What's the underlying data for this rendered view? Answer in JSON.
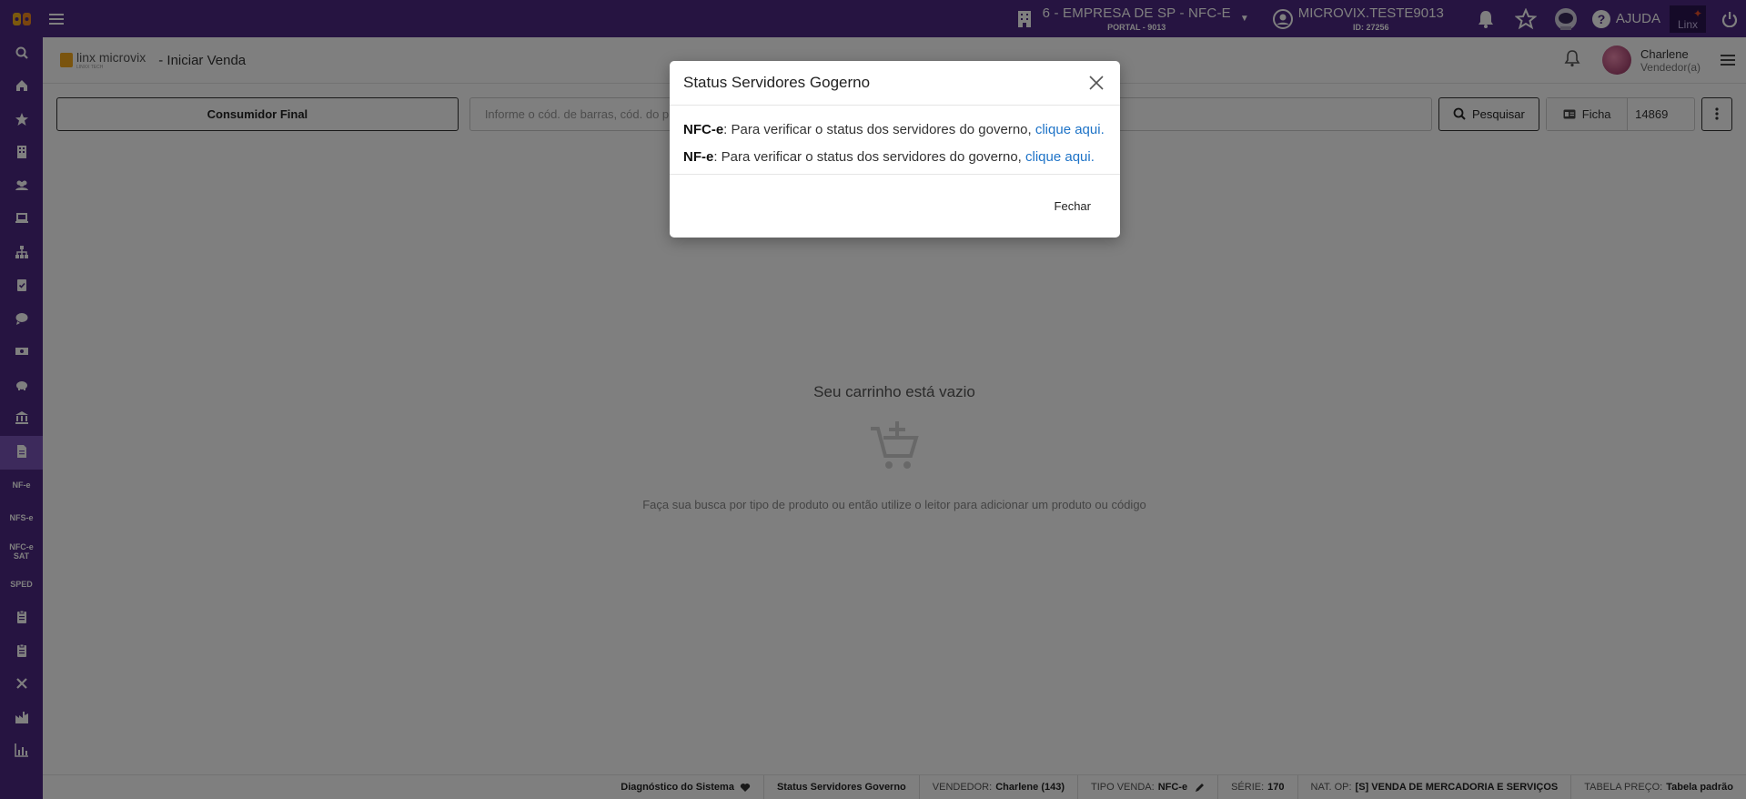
{
  "topbar": {
    "company_line1": "6 - EMPRESA DE SP - NFC-E",
    "company_line2": "PORTAL - 9013",
    "user_line1": "MICROVIX.TESTE9013",
    "user_line2": "ID: 27256",
    "help_label": "AJUDA",
    "brand_badge": "Linx"
  },
  "sidebar": {
    "items": [
      {
        "icon": "search-icon",
        "label": ""
      },
      {
        "icon": "home-icon",
        "label": ""
      },
      {
        "icon": "star-icon",
        "label": ""
      },
      {
        "icon": "building-icon",
        "label": ""
      },
      {
        "icon": "users-icon",
        "label": ""
      },
      {
        "icon": "laptop-icon",
        "label": ""
      },
      {
        "icon": "sitemap-icon",
        "label": ""
      },
      {
        "icon": "clipboard-check-icon",
        "label": ""
      },
      {
        "icon": "chat-icon",
        "label": ""
      },
      {
        "icon": "money-icon",
        "label": ""
      },
      {
        "icon": "piggy-bank-icon",
        "label": ""
      },
      {
        "icon": "bank-icon",
        "label": ""
      },
      {
        "icon": "document-icon",
        "label": ""
      },
      {
        "icon": "",
        "label": "NF-e"
      },
      {
        "icon": "",
        "label": "NFS-e"
      },
      {
        "icon": "",
        "label": "NFC-e SAT"
      },
      {
        "icon": "",
        "label": "SPED"
      },
      {
        "icon": "clipboard-icon",
        "label": ""
      },
      {
        "icon": "clipboard-icon",
        "label": ""
      },
      {
        "icon": "close-icon",
        "label": ""
      },
      {
        "icon": "factory-icon",
        "label": ""
      },
      {
        "icon": "bar-chart-icon",
        "label": ""
      }
    ]
  },
  "header": {
    "brand_name": "linx microvix",
    "brand_sub": "LINXX TECH",
    "page_title": "- Iniciar Venda",
    "seller_name": "Charlene",
    "seller_role": "Vendedor(a)"
  },
  "actionbar": {
    "customer_button": "Consumidor Final",
    "search_placeholder": "Informe o cód. de barras, cód. do p",
    "search_button": "Pesquisar",
    "ficha_label": "Ficha",
    "ficha_value": "14869"
  },
  "empty_cart": {
    "title": "Seu carrinho está vazio",
    "hint": "Faça sua busca por tipo de produto ou então utilize o leitor para adicionar um produto ou código"
  },
  "footer": {
    "diagnostico": "Diagnóstico do Sistema",
    "status_servidores": "Status Servidores Governo",
    "vendedor_label": "VENDEDOR:",
    "vendedor_value": "Charlene (143)",
    "tipo_venda_label": "TIPO VENDA:",
    "tipo_venda_value": "NFC-e",
    "serie_label": "SÉRIE:",
    "serie_value": "170",
    "nat_op_label": "NAT. OP:",
    "nat_op_value": "[S] VENDA DE MERCADORIA E SERVIÇOS",
    "tabela_label": "TABELA PREÇO:",
    "tabela_value": "Tabela padrão"
  },
  "modal": {
    "title": "Status Servidores Gogerno",
    "line1_prefix": "NFC-e",
    "line1_text": ": Para verificar o status dos servidores do governo, ",
    "line1_link": "clique aqui.",
    "line2_prefix": "NF-e",
    "line2_text": ": Para verificar o status dos servidores do governo, ",
    "line2_link": "clique aqui.",
    "close_button": "Fechar"
  },
  "colors": {
    "brand_purple": "#4c2882",
    "sidebar_active": "#7b55b8",
    "link_blue": "#1e73c7"
  }
}
